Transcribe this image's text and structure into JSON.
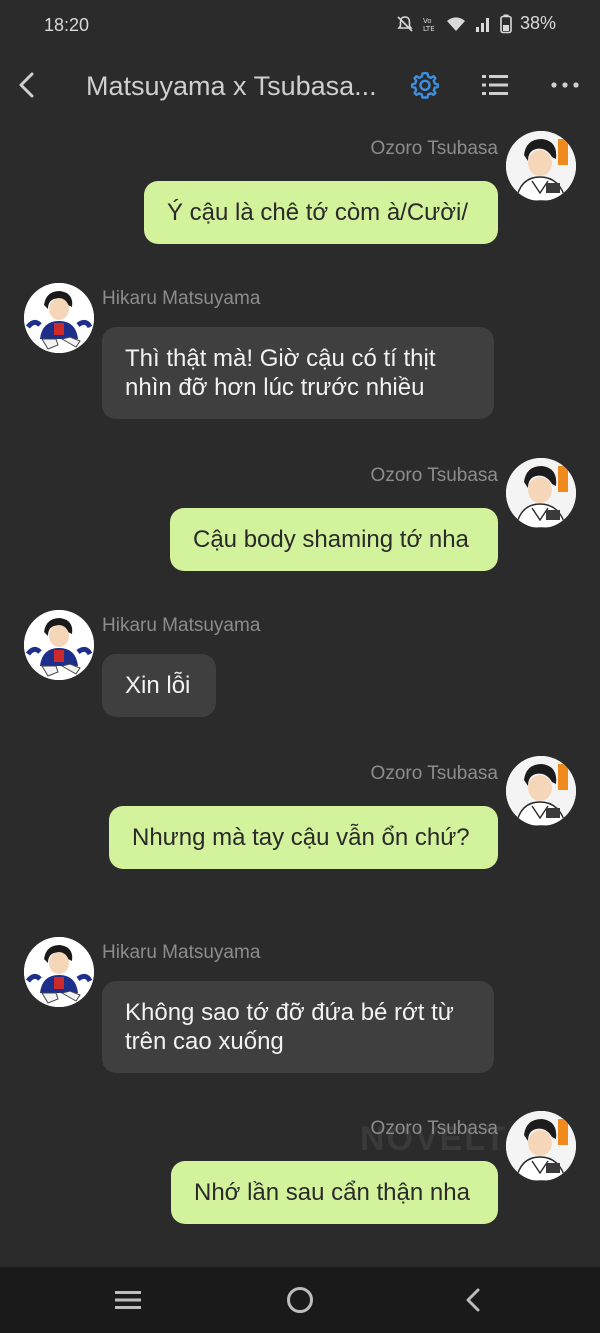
{
  "status": {
    "time": "18:20",
    "battery": "38%"
  },
  "header": {
    "title": "Matsuyama x Tsubasa...",
    "accent": "#3d8fe0"
  },
  "messages": [
    {
      "side": "out",
      "sender": "Ozoro Tsubasa",
      "text": "Ý cậu là chê tớ còm à/Cười/"
    },
    {
      "side": "in",
      "sender": "Hikaru Matsuyama",
      "text": "Thì thật mà! Giờ cậu có tí thịt nhìn đỡ hơn lúc trước nhiều"
    },
    {
      "side": "out",
      "sender": "Ozoro Tsubasa",
      "text": "Cậu body shaming tớ nha"
    },
    {
      "side": "in",
      "sender": "Hikaru Matsuyama",
      "text": "Xin lỗi"
    },
    {
      "side": "out",
      "sender": "Ozoro Tsubasa",
      "text": "Nhưng mà tay cậu vẫn ổn chứ?"
    },
    {
      "side": "in",
      "sender": "Hikaru Matsuyama",
      "text": "Không sao tớ đỡ đứa bé rớt từ trên cao xuống"
    },
    {
      "side": "out",
      "sender": "Ozoro Tsubasa",
      "text": "Nhớ lần sau cẩn thận nha"
    }
  ],
  "watermark": "NOVELTO",
  "colors": {
    "background": "#2b2b2b",
    "outgoing_bubble": "#d2f29c",
    "incoming_bubble": "#3f3f3f"
  }
}
